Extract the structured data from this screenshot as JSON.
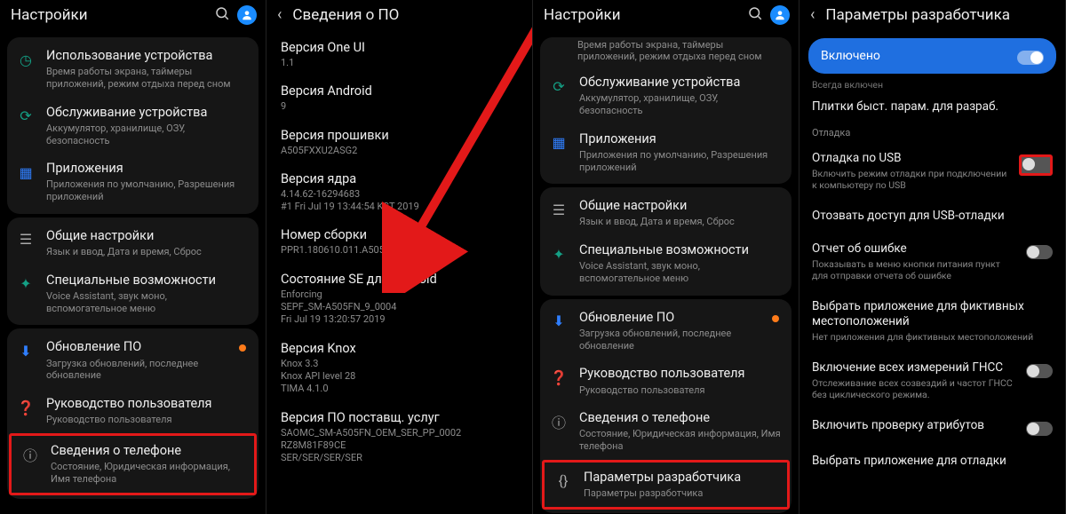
{
  "panel1": {
    "title": "Настройки",
    "items": [
      {
        "icon": "clock-icon",
        "title": "Использование устройства",
        "sub": "Время работы экрана, таймеры приложений, режим отдыха перед сном"
      },
      {
        "icon": "care-icon",
        "title": "Обслуживание устройства",
        "sub": "Аккумулятор, хранилище, ОЗУ, безопасность"
      },
      {
        "icon": "apps-icon",
        "title": "Приложения",
        "sub": "Приложения по умолчанию, Разрешения приложений"
      },
      {
        "icon": "sliders-icon",
        "title": "Общие настройки",
        "sub": "Язык и ввод, Дата и время, Сброс"
      },
      {
        "icon": "access-icon",
        "title": "Специальные возможности",
        "sub": "Voice Assistant, звук моно, вспомогательное меню"
      },
      {
        "icon": "update-icon",
        "title": "Обновление ПО",
        "sub": "Загрузка обновлений, последнее обновление",
        "badge": true
      },
      {
        "icon": "book-icon",
        "title": "Руководство пользователя",
        "sub": "Руководство пользователя"
      },
      {
        "icon": "info-icon",
        "title": "Сведения о телефоне",
        "sub": "Состояние, Юридическая информация, Имя телефона",
        "highlight": true
      }
    ]
  },
  "panel2": {
    "title": "Сведения о ПО",
    "rows": [
      {
        "t": "Версия One UI",
        "s": "1.1"
      },
      {
        "t": "Версия Android",
        "s": "9"
      },
      {
        "t": "Версия прошивки",
        "s": "A505FXXU2ASG2"
      },
      {
        "t": "Версия ядра",
        "s": "4.14.62-16294683\n#1 Fri Jul 19 13:44:54 KST 2019"
      },
      {
        "t": "Номер сборки",
        "s": "PPR1.180610.011.A505FNPUU2ASG3",
        "highlight_text": true
      },
      {
        "t": "Состояние SE для Android",
        "s": "Enforcing\nSEPF_SM-A505FN_9_0004\nFri Jul 19 13:20:57 2019"
      },
      {
        "t": "Версия Knox",
        "s": "Knox 3.3\nKnox API level 28\nTIMA 4.1.0"
      },
      {
        "t": "Версия ПО поставщ. услуг",
        "s": "SAOMC_SM-A505FN_OEM_SER_PP_0002\nRZ8M81F89CE\nSER/SER/SER/SER"
      }
    ]
  },
  "panel3": {
    "title": "Настройки",
    "topcut": "Время работы экрана, таймеры приложений, режим отдыха перед сном",
    "items": [
      {
        "icon": "care-icon",
        "title": "Обслуживание устройства",
        "sub": "Аккумулятор, хранилище, ОЗУ, безопасность"
      },
      {
        "icon": "apps-icon",
        "title": "Приложения",
        "sub": "Приложения по умолчанию, Разрешения приложений"
      },
      {
        "icon": "sliders-icon",
        "title": "Общие настройки",
        "sub": "Язык и ввод, Дата и время, Сброс"
      },
      {
        "icon": "access-icon",
        "title": "Специальные возможности",
        "sub": "Voice Assistant, звук моно, вспомогательное меню"
      },
      {
        "icon": "update-icon",
        "title": "Обновление ПО",
        "sub": "Загрузка обновлений, последнее обновление",
        "badge": true
      },
      {
        "icon": "book-icon",
        "title": "Руководство пользователя",
        "sub": "Руководство пользователя"
      },
      {
        "icon": "info-icon",
        "title": "Сведения о телефоне",
        "sub": "Состояние, Юридическая информация, Имя телефона"
      },
      {
        "icon": "dev-icon",
        "title": "Параметры разработчика",
        "sub": "Параметры разработчика",
        "highlight": true
      }
    ]
  },
  "panel4": {
    "title": "Параметры разработчика",
    "enabled_label": "Включено",
    "always_on_cut": "Всегда включен",
    "quick_tiles": "Плитки быст. парам. для разраб.",
    "section_debug": "Отладка",
    "rows": [
      {
        "t": "Отладка по USB",
        "s": "Включить режим отладки при подключении к компьютеру по USB",
        "toggle": false,
        "highlight_toggle": true
      },
      {
        "t": "Отозвать доступ для USB-отладки",
        "s": ""
      },
      {
        "t": "Отчет об ошибке",
        "s": "Показывать в меню кнопки питания пункт для отправки отчета об ошибке",
        "toggle": false
      },
      {
        "t": "Выбрать приложение для фиктивных местоположений",
        "s": "Нет приложения для фиктивных местоположений"
      },
      {
        "t": "Включение всех измерений ГНСС",
        "s": "Отслеживание всех созвездий и частот ГНСС без циклического режима.",
        "toggle": false
      },
      {
        "t": "Включить проверку атрибутов",
        "s": "",
        "toggle": false
      },
      {
        "t": "Выбрать приложение для отладки",
        "s": ""
      }
    ]
  }
}
